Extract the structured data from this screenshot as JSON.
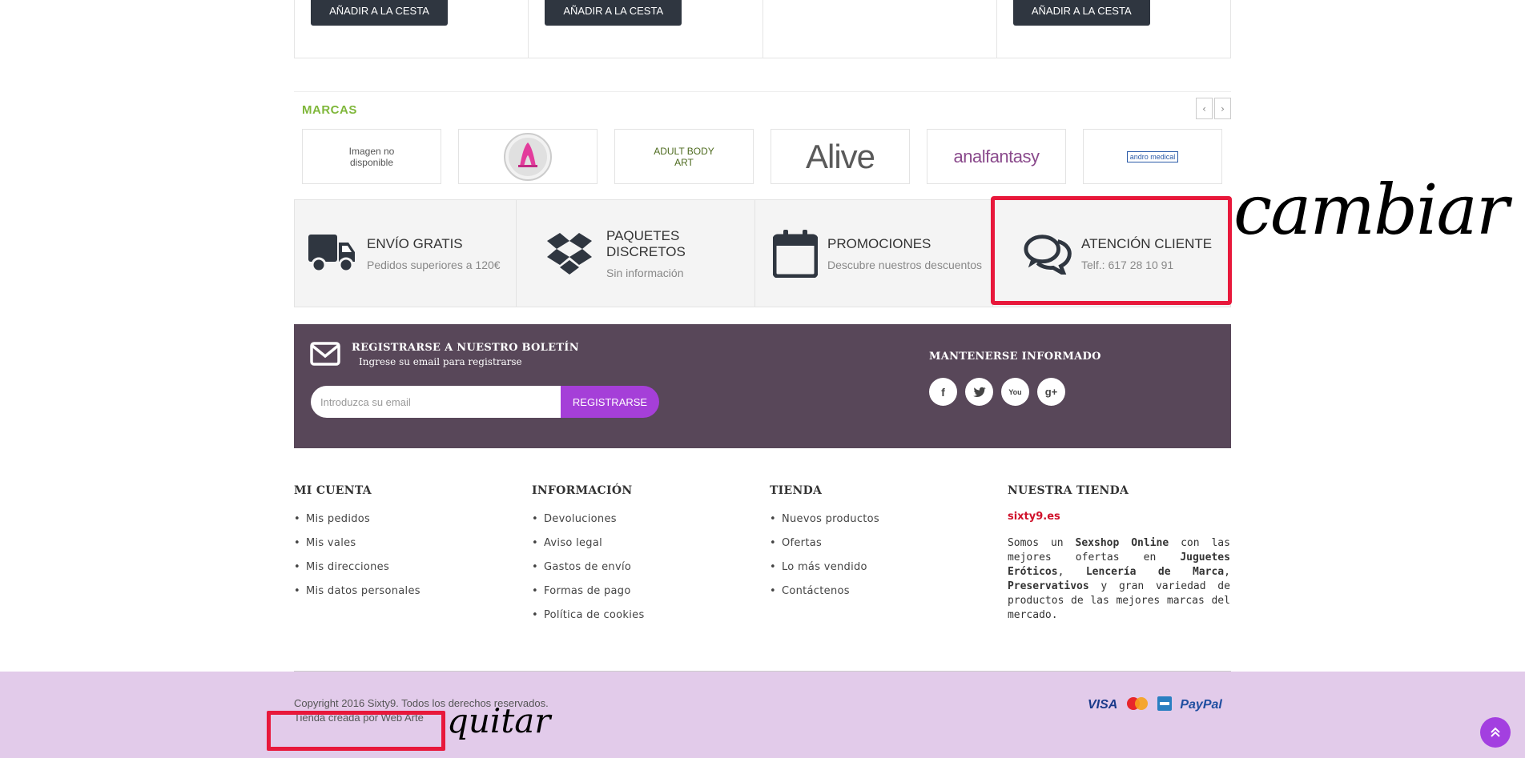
{
  "products": {
    "cart_label": "AÑADIR A LA CESTA"
  },
  "brands": {
    "title": "MARCAS",
    "prev": "‹",
    "next": "›",
    "items": [
      {
        "label": "Imagen no\ndisponible"
      },
      {
        "label": ""
      },
      {
        "label": "ADULT BODY\nART"
      },
      {
        "label": "Alive"
      },
      {
        "label": "analfantasy"
      },
      {
        "label": "andro medical"
      }
    ]
  },
  "features": [
    {
      "title": "ENVÍO GRATIS",
      "sub": "Pedidos superiores a 120€",
      "icon": "truck-icon"
    },
    {
      "title": "PAQUETES DISCRETOS",
      "sub": "Sin información",
      "icon": "dropbox-icon"
    },
    {
      "title": "PROMOCIONES",
      "sub": "Descubre nuestros descuentos",
      "icon": "calendar-icon"
    },
    {
      "title": "ATENCIÓN CLIENTE",
      "sub": "Telf.: 617 28 10 91",
      "icon": "chat-icon"
    }
  ],
  "newsletter": {
    "title": "REGISTRARSE A NUESTRO BOLETÍN",
    "subtitle": "Ingrese su email para registrarse",
    "placeholder": "Introduzca su email",
    "button": "REGISTRARSE",
    "informed_title": "MANTENERSE INFORMADO",
    "socials": [
      {
        "label": "f",
        "icon": "facebook-icon"
      },
      {
        "label": "t",
        "icon": "twitter-icon"
      },
      {
        "label": "You",
        "icon": "youtube-icon"
      },
      {
        "label": "g+",
        "icon": "google-plus-icon"
      }
    ]
  },
  "footer": {
    "account": {
      "title": "MI CUENTA",
      "links": [
        "Mis pedidos",
        "Mis vales",
        "Mis direcciones",
        "Mis datos personales"
      ]
    },
    "info": {
      "title": "INFORMACIÓN",
      "links": [
        "Devoluciones",
        "Aviso legal",
        "Gastos de envío",
        "Formas de pago",
        "Política de cookies"
      ]
    },
    "shop": {
      "title": "TIENDA",
      "links": [
        "Nuevos productos",
        "Ofertas",
        "Lo más vendido",
        "Contáctenos"
      ]
    },
    "store": {
      "title": "NUESTRA TIENDA",
      "link": "sixty9.es",
      "desc": [
        "Somos un ",
        "Sexshop Online",
        " con las mejores ofertas en ",
        "Juguetes Eróticos",
        ", ",
        "Lencería de Marca",
        ", ",
        "Preservativos",
        " y gran variedad de productos de las mejores marcas del mercado."
      ]
    }
  },
  "bottom": {
    "copyright": "Copyright 2016 Sixty9. Todos los derechos reservados.",
    "credit": "Tienda creada por Web Arte",
    "payments": [
      "VISA",
      "MasterCard",
      "Amex",
      "PayPal"
    ]
  },
  "annotations": {
    "change": "cambiar",
    "remove": "quitar"
  },
  "colors": {
    "newsletter_bg": "#584759",
    "accent": "#a53fd8",
    "brand_title": "#7fb73a",
    "store_link": "#d0112b",
    "bottom_bg": "#e2cbea",
    "annotation": "#e8183b"
  }
}
